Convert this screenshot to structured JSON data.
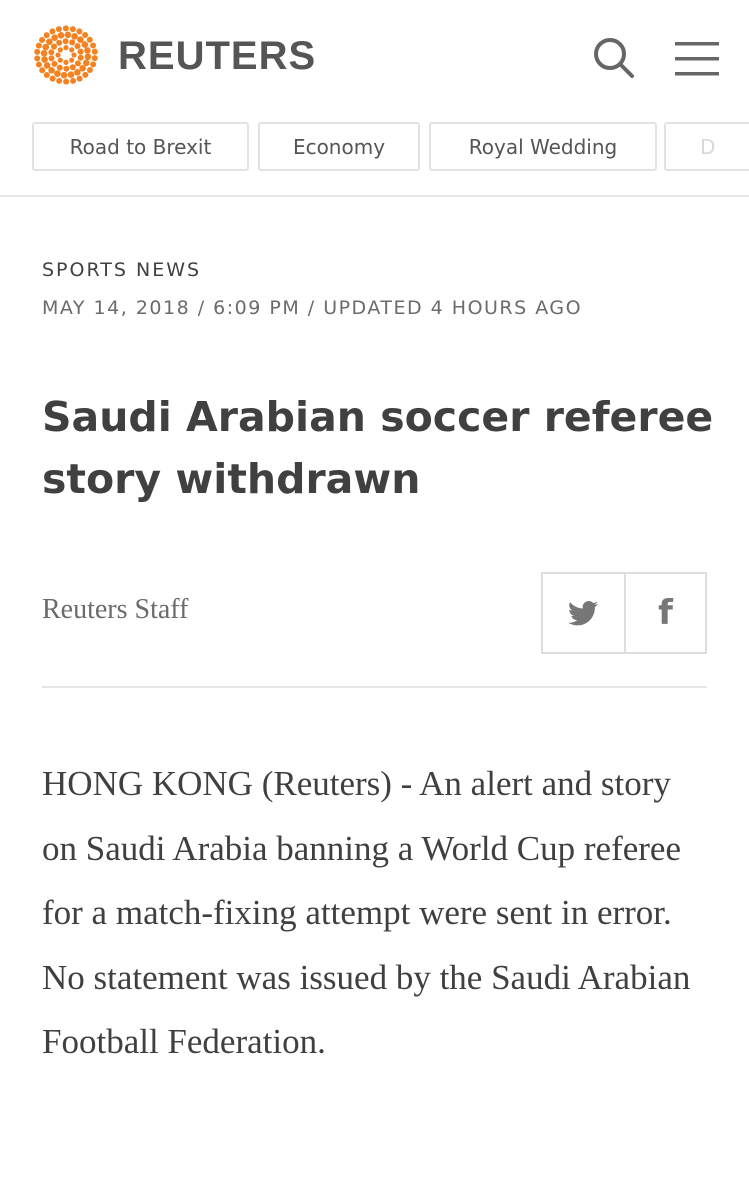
{
  "header": {
    "brand": "REUTERS",
    "logo_icon": "reuters-dot-logo-icon",
    "search_icon": "search-icon",
    "menu_icon": "hamburger-menu-icon",
    "brand_color": "#f58220"
  },
  "tabs": [
    {
      "label": "Road to Brexit"
    },
    {
      "label": "Economy"
    },
    {
      "label": "Royal Wedding"
    },
    {
      "label": "D"
    }
  ],
  "article": {
    "section": "SPORTS NEWS",
    "dateline": "MAY 14, 2018 / 6:09 PM / UPDATED 4 HOURS AGO",
    "headline": "Saudi Arabian soccer referee story withdrawn",
    "byline": "Reuters Staff",
    "share": {
      "twitter_icon": "twitter-icon",
      "facebook_icon": "facebook-icon",
      "facebook_glyph": "f"
    },
    "body": "HONG KONG (Reuters) - An alert and story on Saudi Arabia banning a World Cup referee for a match-fixing attempt were sent in error. No statement was issued by the Saudi Arabian Football Federation."
  }
}
